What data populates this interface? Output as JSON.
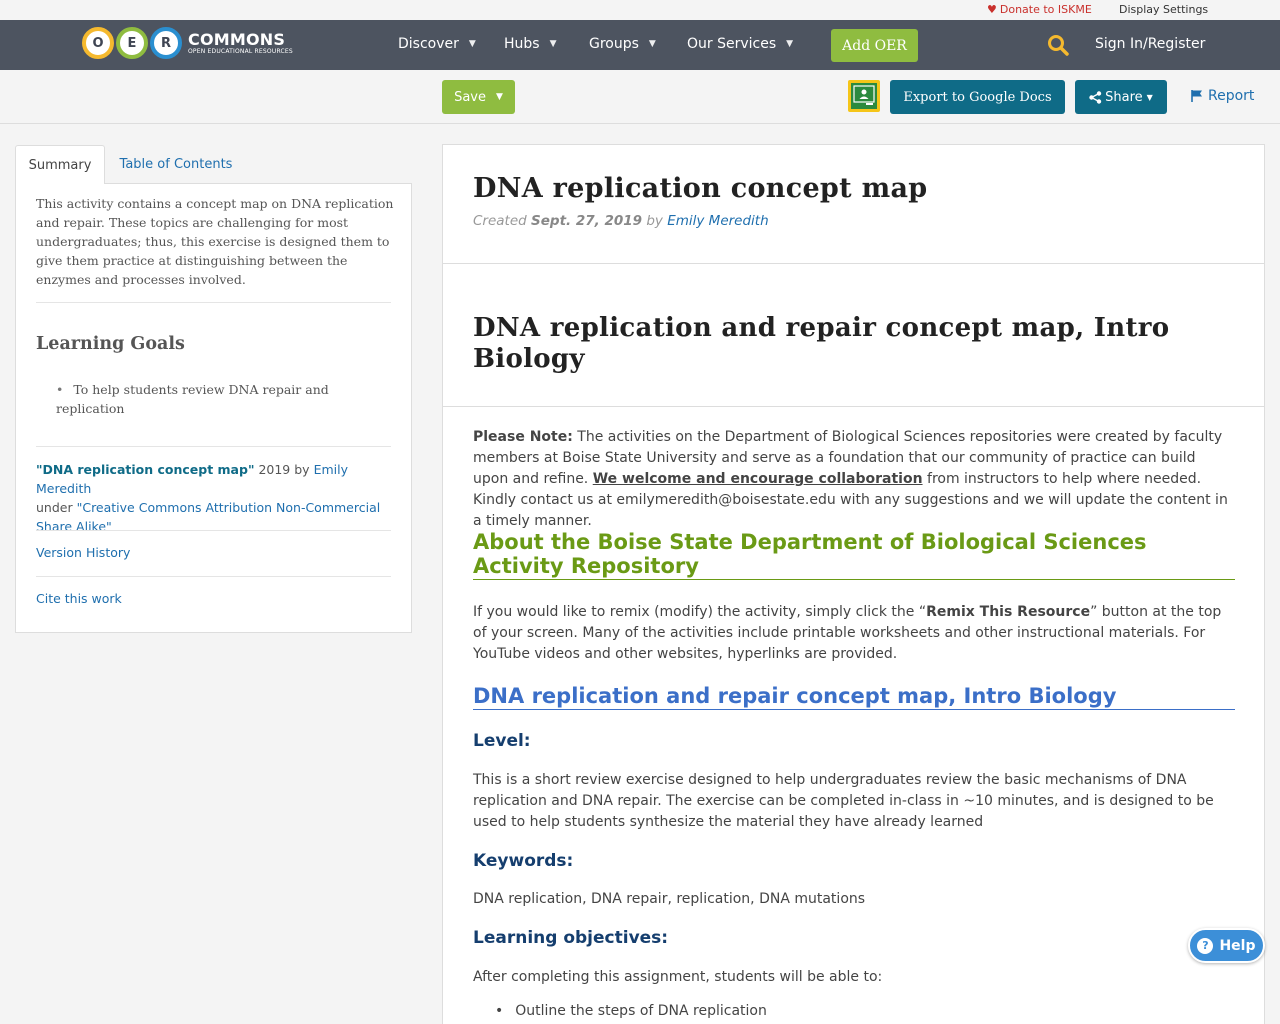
{
  "util": {
    "donate": "Donate to ISKME",
    "display_settings": "Display Settings"
  },
  "nav": {
    "logo_letters": [
      "O",
      "E",
      "R"
    ],
    "logo_big": "COMMONS",
    "logo_small": "OPEN EDUCATIONAL RESOURCES",
    "items": [
      "Discover",
      "Hubs",
      "Groups",
      "Our Services"
    ],
    "add_oer": "Add OER",
    "sign_in": "Sign In/Register"
  },
  "actions": {
    "save": "Save",
    "export": "Export to Google Docs",
    "share": "Share",
    "report": "Report"
  },
  "sidebar": {
    "tabs": [
      "Summary",
      "Table of Contents"
    ],
    "description": "This activity contains a concept map on DNA replication and repair. These topics are challenging for most undergraduates; thus, this exercise is designed them to give them practice at distinguishing between the enzymes and processes involved.",
    "goals_heading": "Learning Goals",
    "goals": [
      "To help students review DNA repair and replication"
    ],
    "attribution": {
      "title": "\"DNA replication concept map\"",
      "year": "2019 by",
      "author": "Emily Meredith",
      "under": "under",
      "license": "\"Creative Commons Attribution Non-Commercial Share Alike\""
    },
    "version_history": "Version History",
    "cite": "Cite this work"
  },
  "main": {
    "title": "DNA replication concept map",
    "created_label": "Created",
    "created_date": "Sept. 27, 2019",
    "by": "by",
    "author": "Emily Meredith",
    "subtitle": "DNA replication and repair concept map, Intro Biology",
    "note_label": "Please Note:",
    "note_text_1": " The activities on the Department of Biological Sciences repositories were created by faculty members at Boise State University and serve as a foundation that our community of practice can build upon and refine.  ",
    "note_link": "We welcome and encourage collaboration",
    "note_text_2": " from instructors to help where needed. Kindly contact us at emilymeredith@boisestate.edu with any suggestions and we will update the content in a timely manner.",
    "about_heading": "About the Boise State Department of Biological Sciences Activity Repository",
    "remix_text_1": "If you would like to remix (modify) the activity, simply click the “",
    "remix_bold": "Remix This Resource",
    "remix_text_2": "” button at the top of your screen. Many of the activities include printable worksheets and other instructional materials. For YouTube videos and other websites, hyperlinks are provided.",
    "section_heading": "DNA replication and repair concept map, Intro Biology",
    "level_heading": "Level:",
    "level_text": "This is a short review exercise designed to help undergraduates review the basic mechanisms of DNA replication and DNA repair. The exercise can be completed in-class in ~10 minutes, and is designed to be used to help students synthesize the material they have already learned",
    "keywords_heading": "Keywords:",
    "keywords_text": "DNA replication, DNA repair, replication, DNA mutations",
    "objectives_heading": "Learning objectives:",
    "objectives_intro": "After completing this assignment, students will be able to:",
    "objectives": [
      "Outline the steps of DNA replication"
    ]
  },
  "help": {
    "label": "Help",
    "q": "?"
  },
  "colors": {
    "nav_bg": "#4d5460",
    "green": "#8fbc40",
    "teal": "#0f6b87",
    "link": "#1f6fae"
  }
}
